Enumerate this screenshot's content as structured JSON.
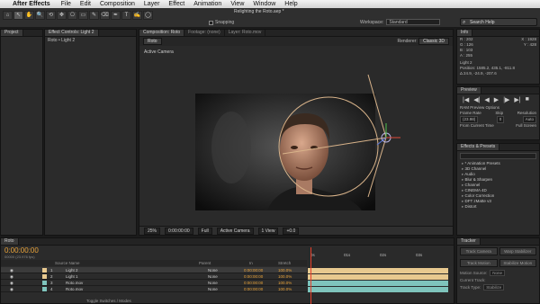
{
  "menubar": {
    "app": "After Effects",
    "items": [
      "File",
      "Edit",
      "Composition",
      "Layer",
      "Effect",
      "Animation",
      "View",
      "Window",
      "Help"
    ]
  },
  "toolbar": {
    "tools": [
      "⌂",
      "↖",
      "✋",
      "🔍",
      "⟲",
      "✥",
      "⎔",
      "▭",
      "✎",
      "⌫",
      "✒",
      "T",
      "✍",
      "◯"
    ],
    "snapping": "Snapping",
    "project_title": "Relighting the Roto.aep *",
    "workspace_label": "Workspace:",
    "workspace_value": "Standard",
    "search_placeholder": "Search Help"
  },
  "panels": {
    "project_tab": "Project",
    "effect_controls_tab": "Effect Controls: Light 2",
    "effect_controls_sub": "Roto • Light 2",
    "comp_tab": "Composition: Roto",
    "footage_tab": "Footage: (none)",
    "layer_tab": "Layer: Roto.mov",
    "comp_chip": "Roto",
    "renderer": "Renderer:",
    "renderer_value": "Classic 3D",
    "active_camera_label": "Active Camera",
    "comp_footer": {
      "zoom": "25%",
      "time": "0:00:00:00",
      "resolution": "Full",
      "view": "Active Camera",
      "views": "1 View",
      "exposure": "+0.0"
    }
  },
  "info": {
    "tab": "Info",
    "r": "R : 202",
    "g": "G : 126",
    "b": "B : 103",
    "a": "A : 255",
    "x": "X : 1928",
    "y": "Y : 428",
    "light_name": "Light 2",
    "position": "Position: 1585.2, 435.1, -811.8",
    "delta": "Δ 24.9, -24.9, -207.6"
  },
  "preview": {
    "tab": "Preview",
    "buttons": [
      "|◀",
      "◀|",
      "◀",
      "▶",
      "|▶",
      "▶|",
      "■"
    ],
    "ram_label": "RAM Preview Options",
    "frame_rate_label": "Frame Rate",
    "skip_label": "Skip",
    "resolution_label": "Resolution",
    "frame_rate_value": "(23.98)",
    "skip_value": "0",
    "resolution_value": "Auto",
    "from_current": "From Current Time",
    "full_screen": "Full Screen"
  },
  "effects_presets": {
    "tab": "Effects & Presets",
    "items": [
      "* Animation Presets",
      "3D Channel",
      "Audio",
      "Blur & Sharpen",
      "Channel",
      "CINEMA 4D",
      "Color Correction",
      "DFT zMatte v3",
      "Distort"
    ]
  },
  "tracker": {
    "tab": "Tracker",
    "buttons": [
      "Track Camera",
      "Warp Stabilizer",
      "Track Motion",
      "Stabilize Motion"
    ],
    "motion_source": "Motion Source:",
    "motion_source_value": "None",
    "current_track": "Current Track:",
    "track_type": "Track Type:",
    "track_type_value": "Stabilize"
  },
  "timeline": {
    "tab": "Roto",
    "timecode": "0:00:00:00",
    "fps": "00000 (23.976 fps)",
    "col_source": "Source Name",
    "col_parent": "Parent",
    "col_in": "In",
    "col_stretch": "Stretch",
    "ruler": [
      "0s",
      "01s",
      "02s",
      "03s"
    ],
    "footer": "Toggle Switches / Modes",
    "layers": [
      {
        "num": "1",
        "name": "Light 2",
        "parent": "None",
        "in": "0:00:00:00",
        "stretch": "100.0%",
        "color": "#e8c98f"
      },
      {
        "num": "2",
        "name": "Light 1",
        "parent": "None",
        "in": "0:00:00:00",
        "stretch": "100.0%",
        "color": "#e8c98f"
      },
      {
        "num": "3",
        "name": "Roto.mov",
        "parent": "None",
        "in": "0:00:00:00",
        "stretch": "100.0%",
        "color": "#7fc4bc"
      },
      {
        "num": "4",
        "name": "Roto.mov",
        "parent": "None",
        "in": "0:00:00:00",
        "stretch": "100.0%",
        "color": "#7fc4bc"
      }
    ]
  }
}
